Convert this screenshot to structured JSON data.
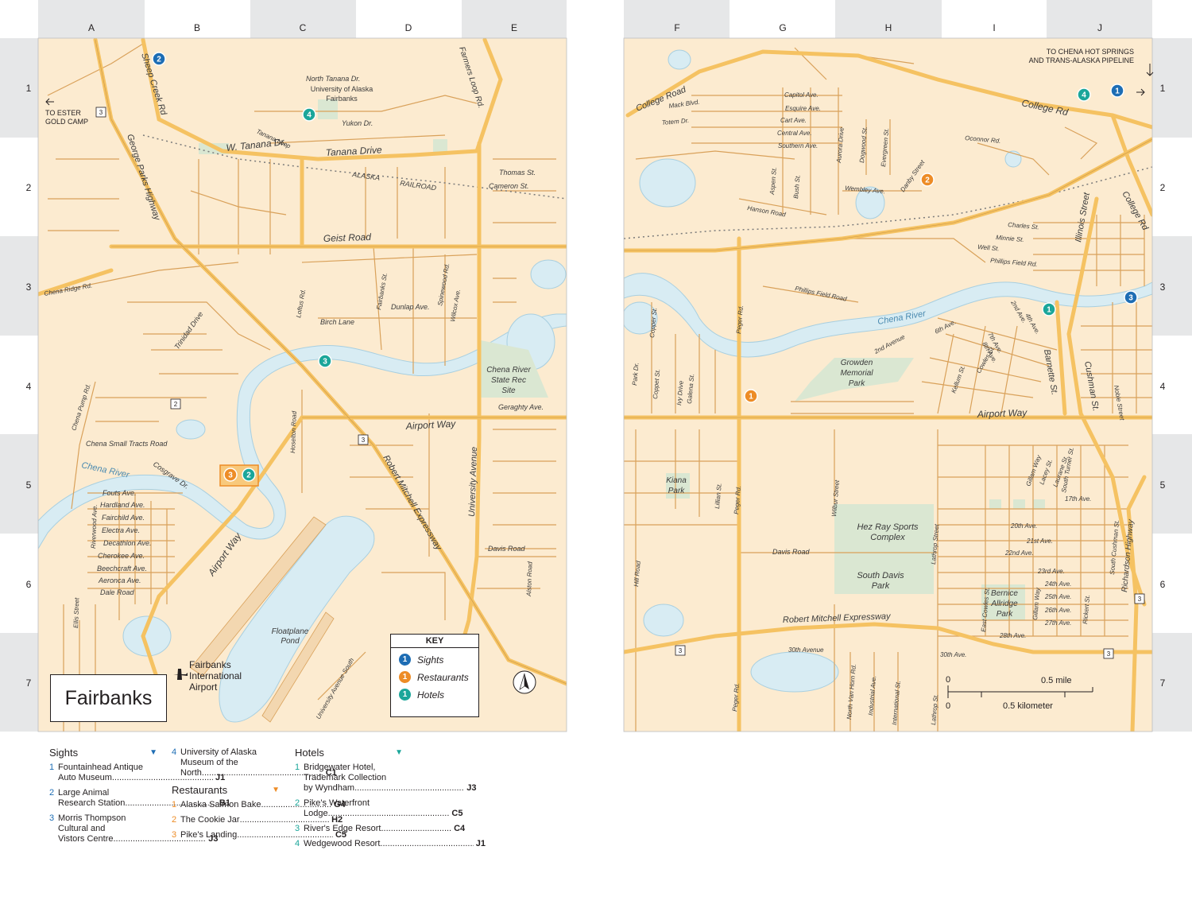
{
  "map_title": "Fairbanks",
  "colors": {
    "land": "#fcebd0",
    "water": "#d8ecf3",
    "park": "#dae7d2",
    "major_road": "#f5c262",
    "minor_road": "#d9a15a",
    "sights": "#1d6db4",
    "restaurants": "#ed8c26",
    "hotels": "#1ba69a"
  },
  "grid": {
    "left_cols": [
      "A",
      "B",
      "C",
      "D",
      "E"
    ],
    "right_cols": [
      "F",
      "G",
      "H",
      "I",
      "J"
    ],
    "rows": [
      "1",
      "2",
      "3",
      "4",
      "5",
      "6",
      "7"
    ]
  },
  "key": {
    "title": "KEY",
    "sights": "Sights",
    "restaurants": "Restaurants",
    "hotels": "Hotels",
    "sample_number": "1"
  },
  "scale": {
    "zero": "0",
    "mile": "0.5 mile",
    "km": "0.5 kilometer"
  },
  "airport_label": [
    "Fairbanks",
    "International",
    "Airport"
  ],
  "outside_labels": {
    "ester": [
      "TO ESTER",
      "GOLD CAMP"
    ],
    "chena_hot_springs": [
      "TO CHENA HOT SPRINGS",
      "AND TRANS-ALASKA PIPELINE"
    ]
  },
  "road_labels_left": [
    "Sheep Creek Rd",
    "George Parks Highway",
    "W. Tanana Dr.",
    "Tanana Drive",
    "Tanana Loop",
    "Yukon Dr.",
    "North Tanana Dr.",
    "ALASKA",
    "RAILROAD",
    "Farmers Loop Rd.",
    "Thomas St.",
    "Cameron St.",
    "Geist Road",
    "Chena Ridge Rd.",
    "Loftus Rd.",
    "Fairbanks St.",
    "Dunlap Ave.",
    "Spinewood Rd.",
    "Wilcox Ave.",
    "Birch Lane",
    "Trinidad Drive",
    "Chena Pump Rd.",
    "Chena Small Tracts Road",
    "Cosgrave Dr.",
    "Hoselton Road",
    "Geraghty Ave.",
    "Airport Way",
    "University Avenue",
    "Robert Mitchell Expressway",
    "Fouts Ave.",
    "Hardland Ave.",
    "Fairchild Ave.",
    "Electra Ave.",
    "Decathlon Ave.",
    "Cherokee Ave.",
    "Beechcraft Ave.",
    "Aeronca Ave.",
    "Dale Road",
    "Riverwood Ave.",
    "Ellis Street",
    "Davis Road",
    "Alston Road",
    "University Avenue South",
    "Airport Way"
  ],
  "road_labels_right": [
    "College Road",
    "Mack Blvd.",
    "Totem Dr.",
    "Capitol Ave.",
    "Esquire Ave.",
    "Cart Ave.",
    "Central Ave.",
    "Southern Ave.",
    "Aurora Drive",
    "Dogwood St.",
    "Evergreen St.",
    "Aspen St.",
    "Bush St.",
    "Wembley Ave.",
    "Danby Street",
    "Hanson Road",
    "Oconnor Rd.",
    "College Rd",
    "College Rd",
    "Charles St.",
    "Minnie St.",
    "Well St.",
    "Phillips Field Rd.",
    "Illinois Street",
    "Phillips Field Road",
    "Copper St.",
    "Peger Rd.",
    "Park Dr.",
    "Coppet St.",
    "Ivy Drive",
    "Galena St.",
    "2nd Avenue",
    "6th Ave.",
    "2nd Ave.",
    "4th Ave.",
    "7th Ave.",
    "8th Ave.",
    "Kellum St.",
    "Cowles St.",
    "Barnette St.",
    "Cushman St.",
    "Noble Street",
    "Airport Way",
    "Lillian St.",
    "Peger Rd.",
    "Wilbur Street",
    "Lathrop Street",
    "Gillam Way",
    "Lacey St.",
    "Laurane St.",
    "South Turner St.",
    "17th Ave.",
    "20th Ave.",
    "21st Ave.",
    "22nd Ave.",
    "Davis Road",
    "Hill Road",
    "23rd Ave.",
    "24th Ave.",
    "25th Ave.",
    "26th Ave.",
    "27th Ave.",
    "28th Ave.",
    "South Cushman St.",
    "Richardson Highway",
    "East Cowles St.",
    "Gillam Way",
    "Rickert St.",
    "Robert Mitchell Expressway",
    "30th Avenue",
    "30th Ave.",
    "Peger Rd.",
    "North Van Horn Rd.",
    "Industrial Ave.",
    "International St.",
    "Lathrop St."
  ],
  "place_labels": {
    "campus": [
      "University of Alaska",
      "Fairbanks"
    ],
    "chena_rec": [
      "Chena River",
      "State Rec",
      "Site"
    ],
    "floatplane": [
      "Floatplane",
      "Pond"
    ],
    "growden": [
      "Growden",
      "Memorial",
      "Park"
    ],
    "kiana": [
      "Kiana",
      "Park"
    ],
    "hez_ray": [
      "Hez Ray Sports",
      "Complex"
    ],
    "south_davis": [
      "South Davis",
      "Park"
    ],
    "bernice": [
      "Bernice",
      "Allridge",
      "Park"
    ],
    "river_left": "Chena River",
    "river_right": "Chena River"
  },
  "highway_shields": [
    "3",
    "3",
    "3",
    "3",
    "3",
    "2"
  ],
  "markers": [
    {
      "type": "sights",
      "label": "2"
    },
    {
      "type": "hotels",
      "label": "4"
    },
    {
      "type": "hotels",
      "label": "3"
    },
    {
      "type": "restaurants",
      "label": "3"
    },
    {
      "type": "hotels",
      "label": "2"
    },
    {
      "type": "restaurants",
      "label": "2"
    },
    {
      "type": "hotels",
      "label": "4"
    },
    {
      "type": "sights",
      "label": "1"
    },
    {
      "type": "hotels",
      "label": "1"
    },
    {
      "type": "sights",
      "label": "3"
    },
    {
      "type": "restaurants",
      "label": "1"
    }
  ],
  "legend": {
    "sights": {
      "title": "Sights",
      "items": [
        {
          "num": "1",
          "lines": [
            "Fountainhead Antique",
            "Auto Museum"
          ],
          "grid": "J1"
        },
        {
          "num": "2",
          "lines": [
            "Large Animal",
            "Research Station"
          ],
          "grid": "B1"
        },
        {
          "num": "3",
          "lines": [
            "Morris Thompson",
            "Cultural and",
            "Vistors Centre"
          ],
          "grid": "J3"
        },
        {
          "num": "4",
          "lines": [
            "University of Alaska",
            "Museum of the",
            "North"
          ],
          "grid": "C1"
        }
      ]
    },
    "restaurants": {
      "title": "Restaurants",
      "items": [
        {
          "num": "1",
          "lines": [
            "Alaska Salmon Bake"
          ],
          "grid": "G4"
        },
        {
          "num": "2",
          "lines": [
            "The Cookie Jar"
          ],
          "grid": "H2"
        },
        {
          "num": "3",
          "lines": [
            "Pike's Landing"
          ],
          "grid": "C5"
        }
      ]
    },
    "hotels": {
      "title": "Hotels",
      "items": [
        {
          "num": "1",
          "lines": [
            "Bridgewater Hotel,",
            "Trademark Collection",
            "by Wyndham"
          ],
          "grid": "J3"
        },
        {
          "num": "2",
          "lines": [
            "Pike's Waterfront",
            "Lodge"
          ],
          "grid": "C5"
        },
        {
          "num": "3",
          "lines": [
            "River's Edge Resort"
          ],
          "grid": "C4"
        },
        {
          "num": "4",
          "lines": [
            "Wedgewood Resort"
          ],
          "grid": "J1"
        }
      ]
    }
  }
}
